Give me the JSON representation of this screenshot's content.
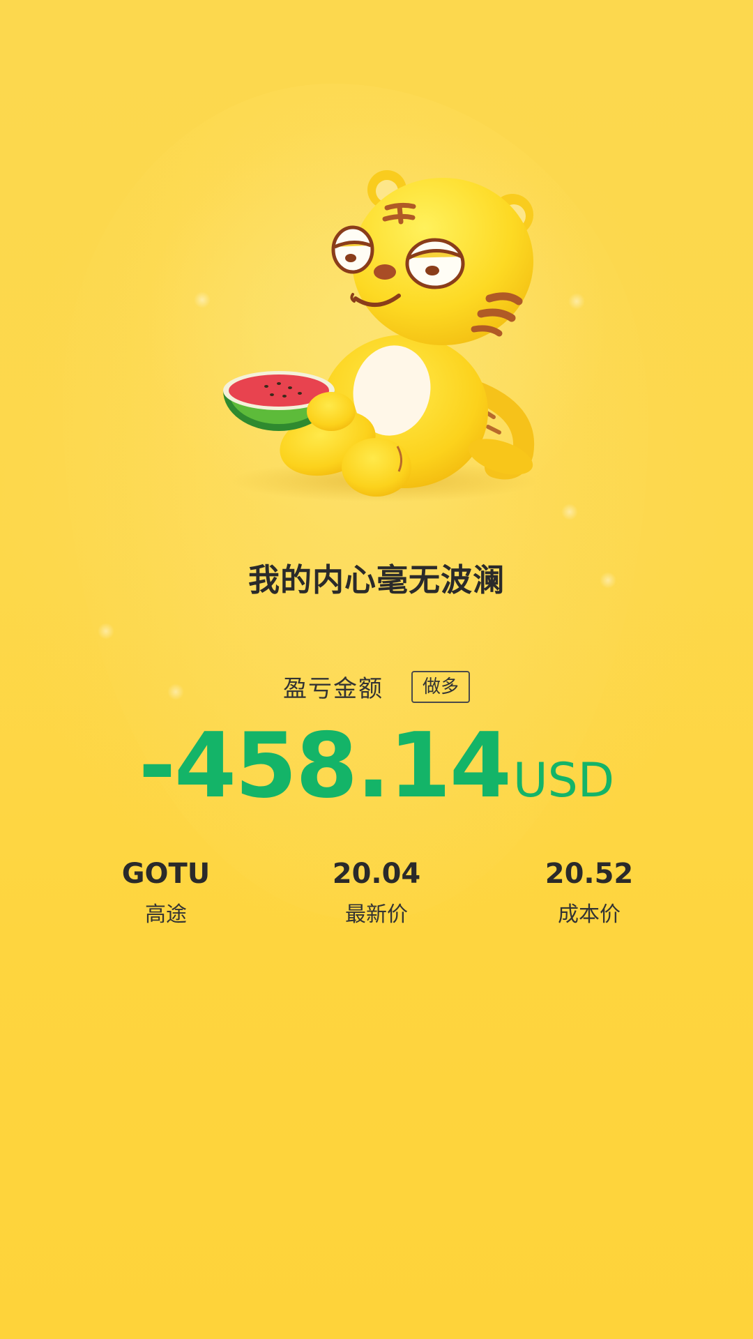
{
  "caption": "我的内心毫无波澜",
  "pnl": {
    "label": "盈亏金额",
    "direction": "做多",
    "amount": "-458.14",
    "unit": "USD",
    "amount_color": "#14b468"
  },
  "stats": [
    {
      "value": "GOTU",
      "label": "高途"
    },
    {
      "value": "20.04",
      "label": "最新价"
    },
    {
      "value": "20.52",
      "label": "成本价"
    }
  ],
  "mascot": {
    "icon": "tiger-mascot-with-watermelon-icon"
  },
  "colors": {
    "background": "#fdd84b",
    "text": "#2a2a2a",
    "loss": "#14b468"
  }
}
